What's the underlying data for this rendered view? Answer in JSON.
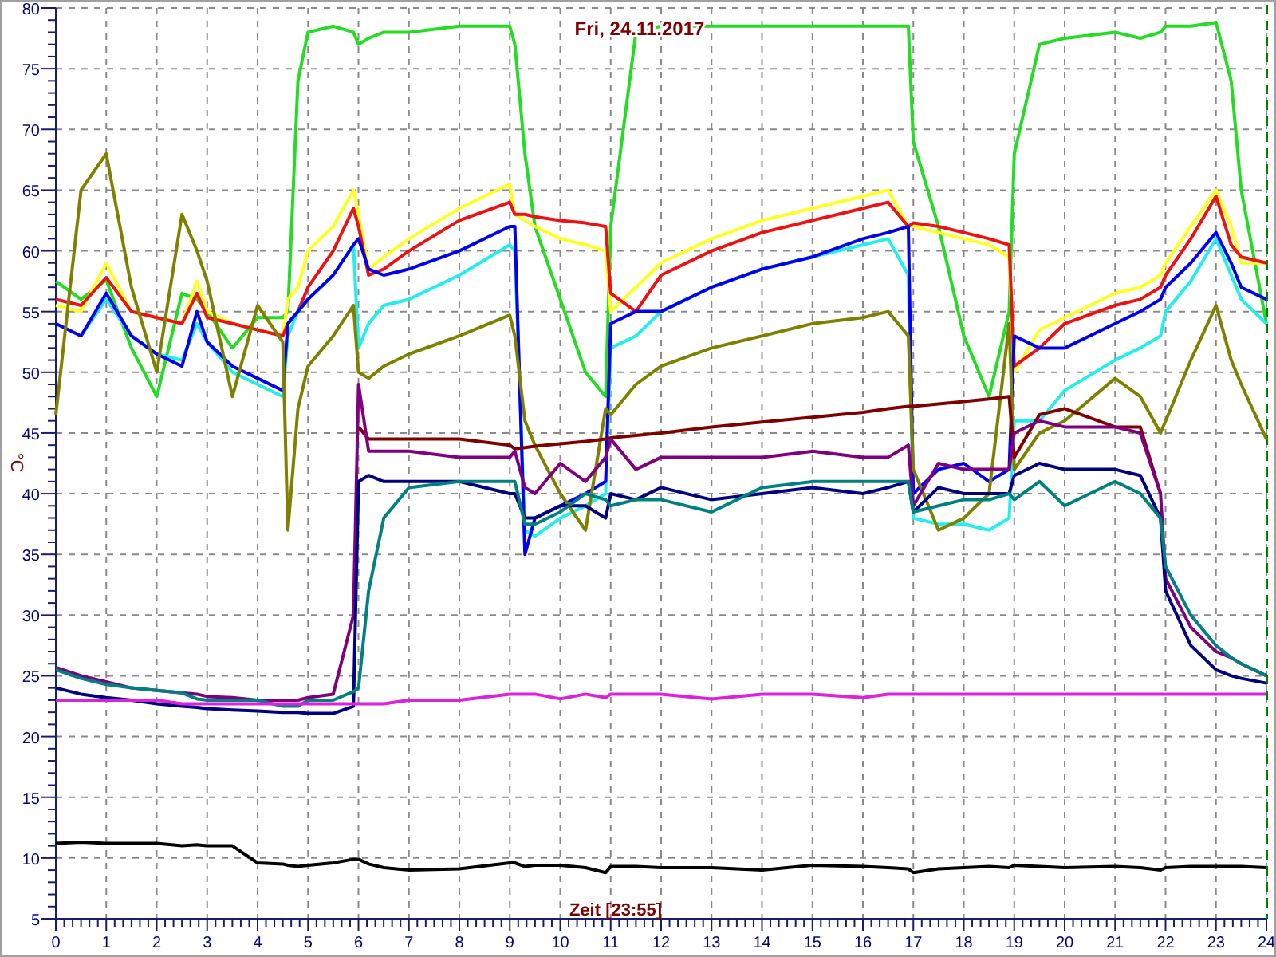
{
  "chart": {
    "chart_data": {
      "type": "line",
      "title": "Fri, 24.11.2017",
      "xlabel": "Zeit [23:55]",
      "ylabel": "°C",
      "grid": true,
      "xlim": [
        0,
        24
      ],
      "ylim": [
        5,
        80
      ],
      "xticks": [
        0,
        1,
        2,
        3,
        4,
        5,
        6,
        7,
        8,
        9,
        10,
        11,
        12,
        13,
        14,
        15,
        16,
        17,
        18,
        19,
        20,
        21,
        22,
        23,
        24
      ],
      "yticks": [
        5,
        10,
        15,
        20,
        25,
        30,
        35,
        40,
        45,
        50,
        55,
        60,
        65,
        70,
        75,
        80
      ],
      "x": [
        0,
        0.5,
        1,
        1.5,
        2,
        2.5,
        2.8,
        3,
        3.5,
        4,
        4.5,
        4.6,
        4.8,
        5,
        5.5,
        5.9,
        6,
        6.2,
        6.5,
        7,
        8,
        9,
        9.1,
        9.3,
        9.5,
        10,
        10.5,
        10.9,
        11,
        11.5,
        12,
        13,
        14,
        15,
        16,
        16.5,
        16.9,
        17,
        17.5,
        18,
        18.5,
        18.9,
        19,
        19.5,
        20,
        21,
        21.5,
        21.9,
        22,
        22.5,
        23,
        23.3,
        23.5,
        24
      ],
      "series": [
        {
          "color": "#22dd22",
          "values": [
            57.5,
            56,
            57.6,
            52,
            48,
            56.5,
            56,
            55,
            52,
            54.5,
            54.5,
            55,
            74,
            78,
            78.5,
            78,
            77,
            77.5,
            78,
            78,
            78.5,
            78.5,
            77,
            68,
            62,
            56,
            50,
            48,
            62,
            78,
            78.5,
            78.5,
            78.5,
            78.5,
            78.5,
            78.5,
            78.5,
            69,
            62,
            53,
            48,
            55,
            68,
            77,
            77.5,
            78,
            77.5,
            78,
            78.5,
            78.5,
            78.8,
            74,
            65,
            54
          ]
        },
        {
          "color": "#ffff22",
          "values": [
            55.5,
            55,
            59,
            55,
            54.5,
            54,
            57.5,
            55,
            54,
            53.5,
            53,
            56,
            57,
            60,
            62,
            65,
            63,
            58.5,
            59.5,
            61,
            63.5,
            65.5,
            63,
            62.5,
            62,
            61,
            60.5,
            60,
            55,
            57,
            59,
            61,
            62.5,
            63.5,
            64.5,
            65,
            62,
            62,
            61.5,
            61,
            60.5,
            59.5,
            50,
            53.5,
            54.5,
            56.5,
            57,
            58,
            59,
            62,
            65,
            62,
            59,
            59
          ]
        },
        {
          "color": "#ee1111",
          "values": [
            56,
            55.5,
            57.8,
            55,
            54.5,
            54,
            56.5,
            54.5,
            54,
            53.5,
            53,
            54,
            55,
            57,
            60,
            63.5,
            62,
            58,
            58.5,
            60,
            62.5,
            64,
            63,
            63,
            62.8,
            62.5,
            62.3,
            62,
            56.5,
            55,
            58,
            60,
            61.5,
            62.5,
            63.5,
            64,
            62,
            62.3,
            62,
            61.5,
            61,
            60.5,
            50.5,
            52,
            54,
            55.5,
            56,
            57,
            58,
            61,
            64.5,
            60.5,
            59.5,
            59
          ]
        },
        {
          "color": "#22eeee",
          "values": [
            null,
            53,
            56,
            53,
            51.5,
            51,
            54,
            52.5,
            50,
            49,
            48,
            53,
            55,
            56,
            58,
            60.5,
            52,
            54,
            55.5,
            56,
            58,
            60.5,
            60,
            37,
            36.5,
            38,
            39,
            40,
            52,
            53,
            55,
            57,
            58.5,
            59.5,
            60.5,
            61,
            58,
            38,
            37.5,
            37.5,
            37,
            38,
            46,
            46,
            48.5,
            51,
            52,
            53,
            55,
            57.5,
            61,
            58,
            56,
            54
          ]
        },
        {
          "color": "#0000ee",
          "values": [
            54,
            53,
            56.5,
            53,
            51.5,
            50.5,
            55,
            52.5,
            50.5,
            49.5,
            48.5,
            54,
            55,
            56,
            58,
            60.5,
            61,
            58.5,
            58,
            58.5,
            60,
            62,
            62,
            35,
            38,
            39,
            40,
            41,
            54,
            55,
            55,
            57,
            58.5,
            59.5,
            61,
            61.5,
            62,
            40,
            42,
            42.5,
            41,
            42,
            53,
            52,
            52,
            54,
            55,
            56,
            57,
            59,
            61.5,
            59,
            57,
            56
          ]
        },
        {
          "color": "#808000",
          "values": [
            46.5,
            65,
            68,
            57,
            50,
            63,
            60,
            57.5,
            48,
            55.5,
            52.5,
            37,
            47,
            50.5,
            53,
            55.5,
            50,
            49.5,
            50.5,
            51.5,
            53,
            54.7,
            53,
            46,
            44,
            40,
            37,
            47,
            46.5,
            49,
            50.5,
            52,
            53,
            54,
            54.5,
            55,
            53,
            42,
            37,
            38,
            40,
            54,
            42,
            45,
            46,
            49.5,
            48,
            45,
            46,
            51,
            55.5,
            51,
            49,
            44.5
          ]
        },
        {
          "color": "#800000",
          "values": [
            null,
            null,
            null,
            null,
            null,
            null,
            null,
            null,
            null,
            null,
            null,
            null,
            null,
            null,
            null,
            null,
            45.5,
            44.5,
            44.5,
            44.5,
            44.5,
            44,
            43.7,
            43.8,
            43.9,
            44.1,
            44.3,
            44.5,
            44.6,
            44.8,
            45,
            45.5,
            45.9,
            46.3,
            46.7,
            47,
            47.2,
            47.2,
            47.4,
            47.6,
            47.8,
            48,
            43,
            46.5,
            47,
            45.5,
            45.5,
            40,
            null,
            null,
            null,
            null,
            null,
            null
          ]
        },
        {
          "color": "#800080",
          "values": [
            25.7,
            25,
            24.5,
            24,
            23.8,
            23.6,
            23.5,
            23.3,
            23.2,
            23,
            23,
            23,
            23,
            23.2,
            23.5,
            30,
            49,
            43.5,
            43.5,
            43.5,
            43,
            43,
            43.5,
            40.5,
            40,
            42.5,
            41,
            43,
            44.5,
            42,
            43,
            43,
            43,
            43.5,
            43,
            43,
            44,
            39,
            42.5,
            42,
            42,
            42,
            45,
            46,
            45.5,
            45.5,
            45,
            40,
            33,
            29,
            27,
            26.5,
            26,
            25
          ]
        },
        {
          "color": "#000080",
          "values": [
            24,
            23.5,
            23.2,
            23,
            22.7,
            22.5,
            22.4,
            22.3,
            22.2,
            22.1,
            22,
            22,
            22,
            21.9,
            21.9,
            22.5,
            41,
            41.5,
            41,
            41,
            41,
            40,
            40,
            38,
            38,
            39,
            39,
            38,
            40,
            39.5,
            40.5,
            39.5,
            40,
            40.5,
            40,
            40.5,
            41,
            38.5,
            40.5,
            40,
            40,
            40,
            41.5,
            42.5,
            42,
            42,
            41.5,
            38,
            32,
            27.5,
            25.5,
            25,
            24.8,
            24.4
          ]
        },
        {
          "color": "#008080",
          "values": [
            25.5,
            24.8,
            24.3,
            24,
            23.8,
            23.6,
            23.1,
            23,
            23,
            23,
            22.5,
            22.5,
            22.5,
            23,
            23,
            23.7,
            24,
            32,
            38,
            40.5,
            41,
            41,
            41,
            37.5,
            37.5,
            38.5,
            40,
            39.5,
            39,
            39.5,
            39.5,
            38.5,
            40.5,
            41,
            41,
            41,
            41,
            38.5,
            39,
            39.5,
            39.5,
            40,
            39.5,
            41,
            39,
            41,
            40,
            38,
            34,
            30,
            27.5,
            26.5,
            26,
            25
          ]
        },
        {
          "color": "#dd22dd",
          "values": [
            23,
            23,
            23,
            23,
            23,
            22.7,
            22.7,
            22.7,
            22.7,
            22.7,
            22.7,
            22.7,
            22.7,
            22.7,
            22.7,
            22.7,
            22.7,
            22.7,
            22.7,
            23,
            23,
            23.5,
            23.5,
            23.5,
            23.5,
            23.1,
            23.5,
            23.2,
            23.5,
            23.5,
            23.5,
            23.1,
            23.5,
            23.5,
            23.2,
            23.5,
            23.5,
            23.5,
            23.5,
            23.5,
            23.5,
            23.5,
            23.5,
            23.5,
            23.5,
            23.5,
            23.5,
            23.5,
            23.5,
            23.5,
            23.5,
            23.5,
            23.5,
            23.5
          ]
        },
        {
          "color": "#000000",
          "values": [
            11.2,
            11.3,
            11.2,
            11.2,
            11.2,
            11,
            11.1,
            11,
            11,
            9.6,
            9.5,
            9.4,
            9.3,
            9.4,
            9.6,
            9.9,
            9.9,
            9.5,
            9.2,
            9,
            9.1,
            9.6,
            9.6,
            9.3,
            9.4,
            9.4,
            9.2,
            8.8,
            9.3,
            9.3,
            9.2,
            9.2,
            9,
            9.4,
            9.3,
            9.2,
            9.1,
            8.8,
            9.1,
            9.2,
            9.3,
            9.2,
            9.4,
            9.3,
            9.2,
            9.3,
            9.2,
            9,
            9.2,
            9.3,
            9.3,
            9.3,
            9.3,
            9.2
          ]
        }
      ]
    }
  }
}
